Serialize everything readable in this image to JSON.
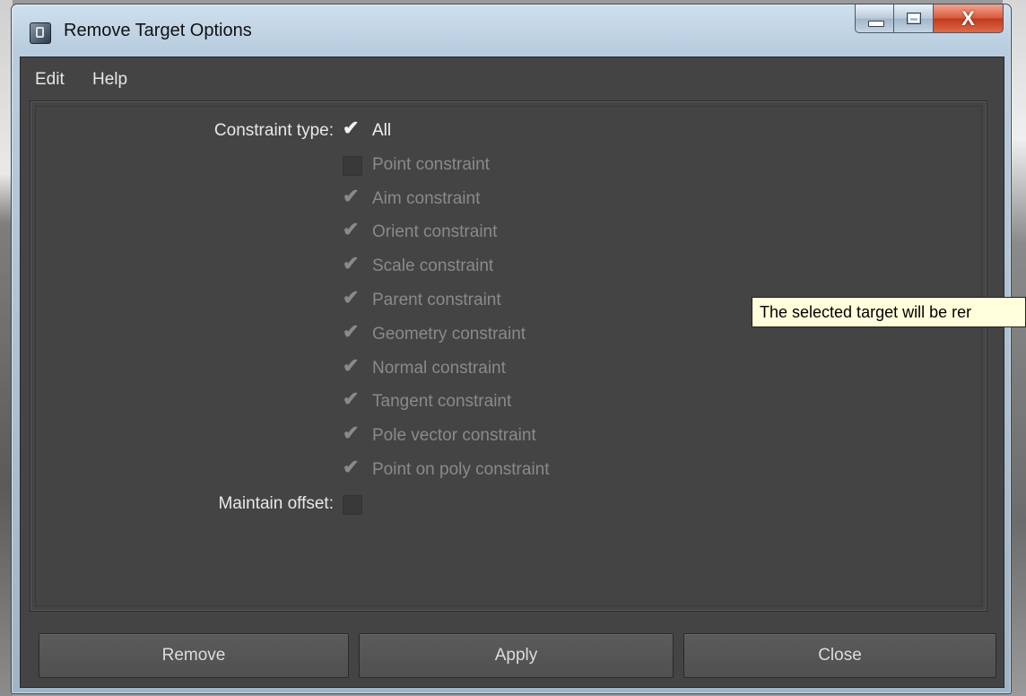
{
  "window": {
    "title": "Remove Target Options"
  },
  "window_controls": {
    "minimize": "minimize",
    "maximize": "maximize",
    "close_glyph": "X"
  },
  "menu": {
    "items": [
      "Edit",
      "Help"
    ]
  },
  "form": {
    "constraint_type_label": "Constraint type:",
    "options": [
      {
        "label": "All",
        "checked": true,
        "enabled": true
      },
      {
        "label": "Point constraint",
        "checked": false,
        "enabled": false
      },
      {
        "label": "Aim constraint",
        "checked": true,
        "enabled": false
      },
      {
        "label": "Orient constraint",
        "checked": true,
        "enabled": false
      },
      {
        "label": "Scale constraint",
        "checked": true,
        "enabled": false
      },
      {
        "label": "Parent constraint",
        "checked": true,
        "enabled": false
      },
      {
        "label": "Geometry constraint",
        "checked": true,
        "enabled": false
      },
      {
        "label": "Normal constraint",
        "checked": true,
        "enabled": false
      },
      {
        "label": "Tangent constraint",
        "checked": true,
        "enabled": false
      },
      {
        "label": "Pole vector constraint",
        "checked": true,
        "enabled": false
      },
      {
        "label": "Point on poly constraint",
        "checked": true,
        "enabled": false
      }
    ],
    "maintain_offset_label": "Maintain offset:",
    "maintain_offset_checked": false
  },
  "tooltip": {
    "text": "The selected target will be rer"
  },
  "buttons": {
    "remove": "Remove",
    "apply": "Apply",
    "close": "Close"
  },
  "icons": {
    "check": "checkmark-icon",
    "app": "maya-app-icon"
  }
}
